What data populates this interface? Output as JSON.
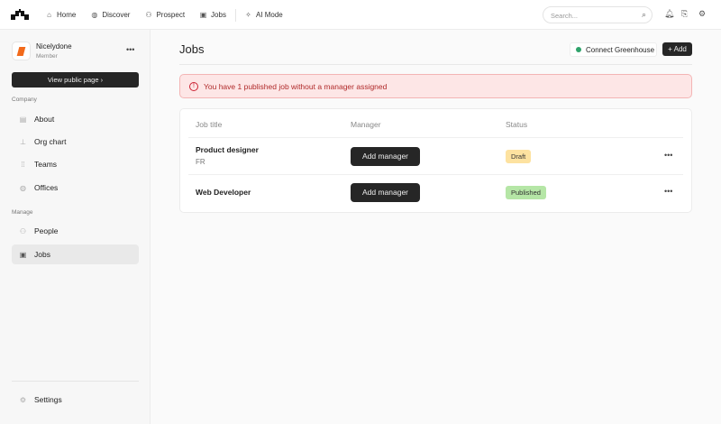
{
  "nav": {
    "items": [
      {
        "label": "Home",
        "icon": "home-icon"
      },
      {
        "label": "Discover",
        "icon": "globe-icon"
      },
      {
        "label": "Prospect",
        "icon": "users-icon"
      },
      {
        "label": "Jobs",
        "icon": "briefcase-icon"
      },
      {
        "label": "AI Mode",
        "icon": "sparkle-icon"
      }
    ],
    "search_placeholder": "Search..."
  },
  "sidebar": {
    "org_name": "Nicelydone",
    "org_role": "Member",
    "view_public": "View public page ›",
    "company_label": "Company",
    "company_items": [
      "About",
      "Org chart",
      "Teams",
      "Offices"
    ],
    "manage_label": "Manage",
    "manage_items": [
      "People",
      "Jobs"
    ],
    "settings": "Settings"
  },
  "main": {
    "title": "Jobs",
    "connect": "Connect Greenhouse",
    "add": "+ Add",
    "alert": "You have 1 published job without a manager assigned",
    "columns": [
      "Job title",
      "Manager",
      "Status"
    ],
    "rows": [
      {
        "title": "Product designer",
        "location": "FR",
        "manager_button": "Add manager",
        "status": "Draft",
        "status_color": "#fde2a0"
      },
      {
        "title": "Web Developer",
        "manager_button": "Add manager",
        "status": "Published",
        "status_color": "#b5e6a6"
      }
    ]
  }
}
